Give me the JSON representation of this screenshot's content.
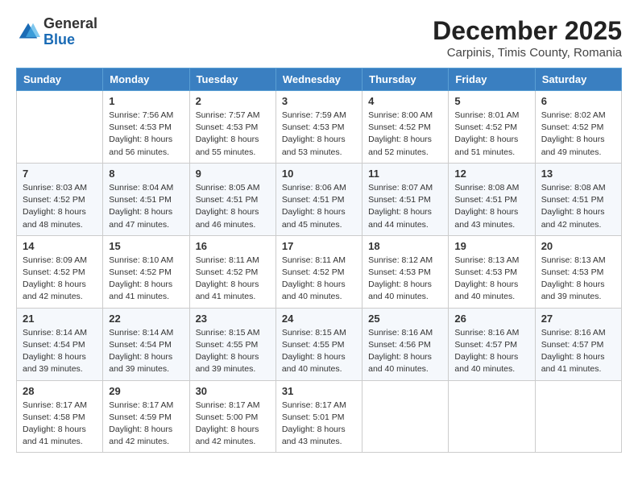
{
  "header": {
    "logo_general": "General",
    "logo_blue": "Blue",
    "month_title": "December 2025",
    "location": "Carpinis, Timis County, Romania"
  },
  "calendar": {
    "weekdays": [
      "Sunday",
      "Monday",
      "Tuesday",
      "Wednesday",
      "Thursday",
      "Friday",
      "Saturday"
    ],
    "weeks": [
      [
        {
          "day": "",
          "info": ""
        },
        {
          "day": "1",
          "info": "Sunrise: 7:56 AM\nSunset: 4:53 PM\nDaylight: 8 hours\nand 56 minutes."
        },
        {
          "day": "2",
          "info": "Sunrise: 7:57 AM\nSunset: 4:53 PM\nDaylight: 8 hours\nand 55 minutes."
        },
        {
          "day": "3",
          "info": "Sunrise: 7:59 AM\nSunset: 4:53 PM\nDaylight: 8 hours\nand 53 minutes."
        },
        {
          "day": "4",
          "info": "Sunrise: 8:00 AM\nSunset: 4:52 PM\nDaylight: 8 hours\nand 52 minutes."
        },
        {
          "day": "5",
          "info": "Sunrise: 8:01 AM\nSunset: 4:52 PM\nDaylight: 8 hours\nand 51 minutes."
        },
        {
          "day": "6",
          "info": "Sunrise: 8:02 AM\nSunset: 4:52 PM\nDaylight: 8 hours\nand 49 minutes."
        }
      ],
      [
        {
          "day": "7",
          "info": "Sunrise: 8:03 AM\nSunset: 4:52 PM\nDaylight: 8 hours\nand 48 minutes."
        },
        {
          "day": "8",
          "info": "Sunrise: 8:04 AM\nSunset: 4:51 PM\nDaylight: 8 hours\nand 47 minutes."
        },
        {
          "day": "9",
          "info": "Sunrise: 8:05 AM\nSunset: 4:51 PM\nDaylight: 8 hours\nand 46 minutes."
        },
        {
          "day": "10",
          "info": "Sunrise: 8:06 AM\nSunset: 4:51 PM\nDaylight: 8 hours\nand 45 minutes."
        },
        {
          "day": "11",
          "info": "Sunrise: 8:07 AM\nSunset: 4:51 PM\nDaylight: 8 hours\nand 44 minutes."
        },
        {
          "day": "12",
          "info": "Sunrise: 8:08 AM\nSunset: 4:51 PM\nDaylight: 8 hours\nand 43 minutes."
        },
        {
          "day": "13",
          "info": "Sunrise: 8:08 AM\nSunset: 4:51 PM\nDaylight: 8 hours\nand 42 minutes."
        }
      ],
      [
        {
          "day": "14",
          "info": "Sunrise: 8:09 AM\nSunset: 4:52 PM\nDaylight: 8 hours\nand 42 minutes."
        },
        {
          "day": "15",
          "info": "Sunrise: 8:10 AM\nSunset: 4:52 PM\nDaylight: 8 hours\nand 41 minutes."
        },
        {
          "day": "16",
          "info": "Sunrise: 8:11 AM\nSunset: 4:52 PM\nDaylight: 8 hours\nand 41 minutes."
        },
        {
          "day": "17",
          "info": "Sunrise: 8:11 AM\nSunset: 4:52 PM\nDaylight: 8 hours\nand 40 minutes."
        },
        {
          "day": "18",
          "info": "Sunrise: 8:12 AM\nSunset: 4:53 PM\nDaylight: 8 hours\nand 40 minutes."
        },
        {
          "day": "19",
          "info": "Sunrise: 8:13 AM\nSunset: 4:53 PM\nDaylight: 8 hours\nand 40 minutes."
        },
        {
          "day": "20",
          "info": "Sunrise: 8:13 AM\nSunset: 4:53 PM\nDaylight: 8 hours\nand 39 minutes."
        }
      ],
      [
        {
          "day": "21",
          "info": "Sunrise: 8:14 AM\nSunset: 4:54 PM\nDaylight: 8 hours\nand 39 minutes."
        },
        {
          "day": "22",
          "info": "Sunrise: 8:14 AM\nSunset: 4:54 PM\nDaylight: 8 hours\nand 39 minutes."
        },
        {
          "day": "23",
          "info": "Sunrise: 8:15 AM\nSunset: 4:55 PM\nDaylight: 8 hours\nand 39 minutes."
        },
        {
          "day": "24",
          "info": "Sunrise: 8:15 AM\nSunset: 4:55 PM\nDaylight: 8 hours\nand 40 minutes."
        },
        {
          "day": "25",
          "info": "Sunrise: 8:16 AM\nSunset: 4:56 PM\nDaylight: 8 hours\nand 40 minutes."
        },
        {
          "day": "26",
          "info": "Sunrise: 8:16 AM\nSunset: 4:57 PM\nDaylight: 8 hours\nand 40 minutes."
        },
        {
          "day": "27",
          "info": "Sunrise: 8:16 AM\nSunset: 4:57 PM\nDaylight: 8 hours\nand 41 minutes."
        }
      ],
      [
        {
          "day": "28",
          "info": "Sunrise: 8:17 AM\nSunset: 4:58 PM\nDaylight: 8 hours\nand 41 minutes."
        },
        {
          "day": "29",
          "info": "Sunrise: 8:17 AM\nSunset: 4:59 PM\nDaylight: 8 hours\nand 42 minutes."
        },
        {
          "day": "30",
          "info": "Sunrise: 8:17 AM\nSunset: 5:00 PM\nDaylight: 8 hours\nand 42 minutes."
        },
        {
          "day": "31",
          "info": "Sunrise: 8:17 AM\nSunset: 5:01 PM\nDaylight: 8 hours\nand 43 minutes."
        },
        {
          "day": "",
          "info": ""
        },
        {
          "day": "",
          "info": ""
        },
        {
          "day": "",
          "info": ""
        }
      ]
    ]
  }
}
